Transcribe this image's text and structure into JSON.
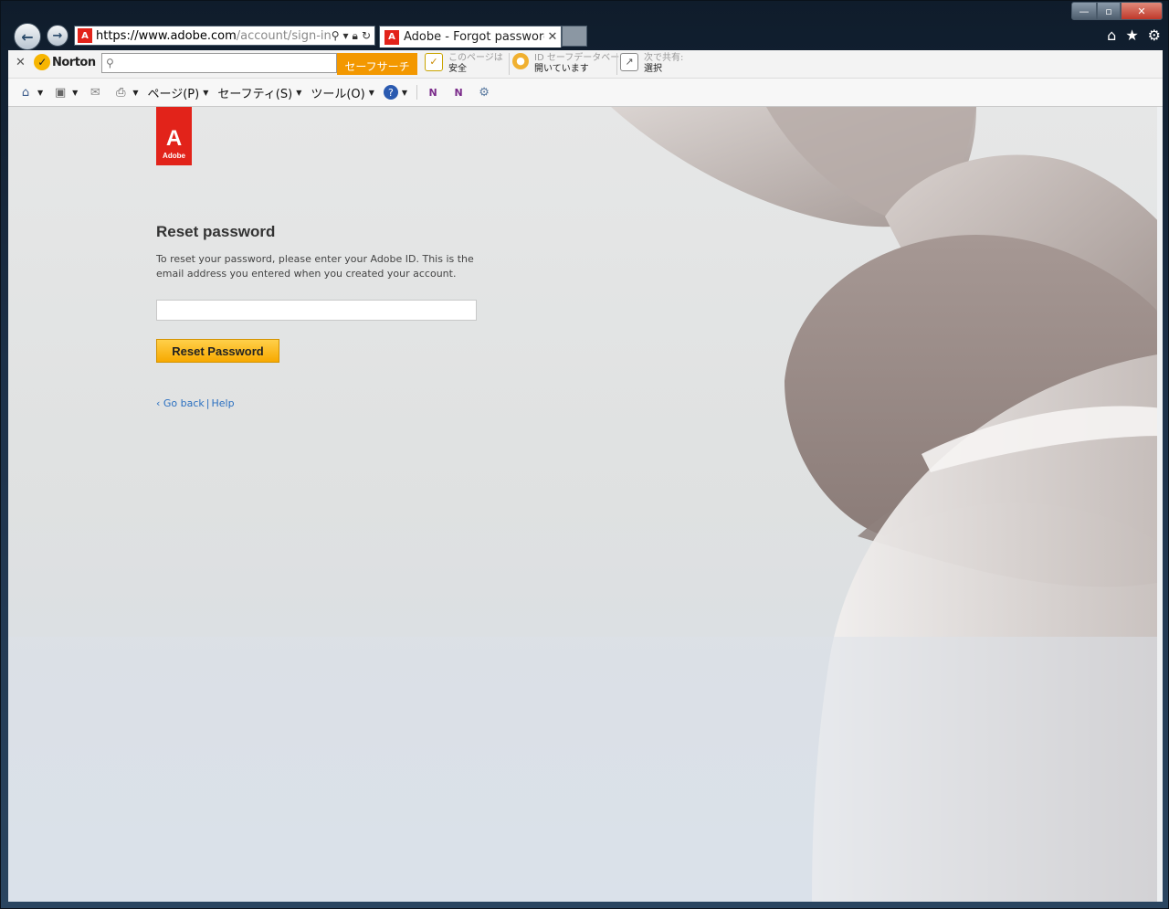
{
  "window": {
    "controls": {
      "minimize": "—",
      "maximize": "▫",
      "close": "✕"
    }
  },
  "nav": {
    "back_icon": "back-arrow-icon",
    "forward_icon": "forward-arrow-icon",
    "address": {
      "protocol": "https://",
      "domain": "www.adobe.com",
      "path": "/account/sign-in"
    },
    "tab_title": "Adobe - Forgot password",
    "tab_close": "✕",
    "right_icons": [
      "home-icon",
      "star-icon",
      "gear-icon"
    ]
  },
  "norton": {
    "close": "✕",
    "brand": "Norton",
    "search_button": "セーフサーチ",
    "page_status": {
      "line1": "このページは",
      "line2": "安全"
    },
    "identity": {
      "line1": "ID セーフデータベース",
      "line2": "開いています"
    },
    "share": {
      "line1": "次で共有:",
      "line2": "選択"
    }
  },
  "cmdbar": {
    "page": "ページ(P)",
    "safety": "セーフティ(S)",
    "tools": "ツール(O)"
  },
  "page": {
    "logo_word": "Adobe",
    "heading": "Reset password",
    "description": "To reset your password, please enter your Adobe ID. This is the email address you entered when you created your account.",
    "email_value": "",
    "reset_button": "Reset Password",
    "go_back": "‹ Go back",
    "link_sep": "|",
    "help": "Help"
  },
  "colors": {
    "adobe_red": "#e2231a",
    "norton_orange": "#f39800",
    "button_yellow": "#f7a900",
    "link_blue": "#2a6fc0"
  }
}
